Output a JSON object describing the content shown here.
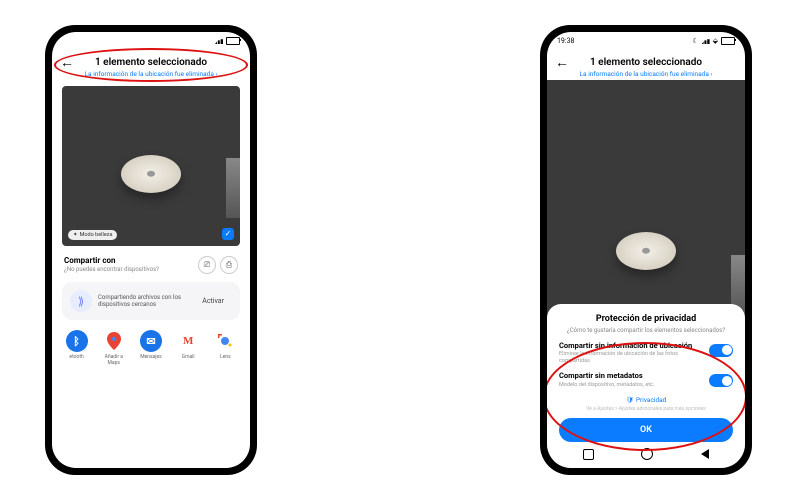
{
  "left": {
    "statusbar": {
      "time": ""
    },
    "header": {
      "title": "1 elemento seleccionado",
      "subtitle": "La información de la ubicación fue eliminada ›"
    },
    "photo": {
      "beauty_chip": "Modo belleza",
      "checked": true
    },
    "share": {
      "title": "Compartir con",
      "hint": "¿No puedes encontrar dispositivos?"
    },
    "nearby": {
      "text": "Compartiendo archivos con los dispositivos cercanos",
      "action": "Activar"
    },
    "apps": [
      {
        "name": "Bluetooth",
        "label": "etooth",
        "bg": "#1a73e8",
        "glyph": "✱",
        "fg": "#fff"
      },
      {
        "name": "Maps",
        "label": "Añadir a Maps",
        "bg": "#fff",
        "glyph": "⬧",
        "fg": "#34a853"
      },
      {
        "name": "Mensajes",
        "label": "Mensajes",
        "bg": "#1a73e8",
        "glyph": "▬",
        "fg": "#fff"
      },
      {
        "name": "Gmail",
        "label": "Gmail",
        "bg": "#fff",
        "glyph": "M",
        "fg": "#ea4335"
      },
      {
        "name": "Lens",
        "label": "Lens",
        "bg": "#fff",
        "glyph": "◐",
        "fg": "#4285f4"
      }
    ]
  },
  "right": {
    "statusbar": {
      "time": "19:38"
    },
    "header": {
      "title": "1 elemento seleccionado",
      "subtitle": "La información de la ubicación fue eliminada ›"
    },
    "sheet": {
      "title": "Protección de privacidad",
      "question": "¿Cómo te gustaría compartir los elementos seleccionados?",
      "opt1": {
        "title": "Compartir sin información de ubicación",
        "desc": "Eliminar la información de ubicación de las fotos compartidas",
        "on": true
      },
      "opt2": {
        "title": "Compartir sin metadatos",
        "desc": "Modelo del dispositivo, metadatos, etc.",
        "on": true
      },
      "privacy_link": "Privacidad",
      "tiny": "Ve a Ajustes > Ajustes adicionales para más opciones",
      "ok": "OK"
    }
  }
}
